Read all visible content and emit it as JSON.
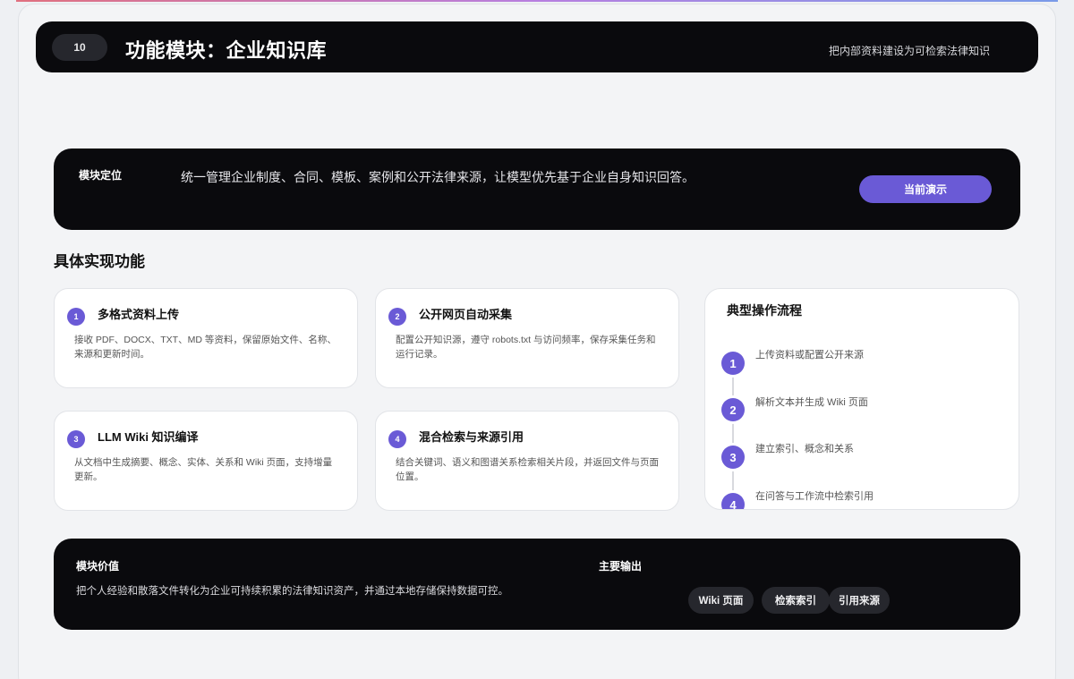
{
  "header": {
    "page_number": "10",
    "title": "功能模块：企业知识库",
    "subtitle": "把内部资料建设为可检索法律知识"
  },
  "positioning": {
    "label": "模块定位",
    "description": "统一管理企业制度、合同、模板、案例和公开法律来源，让模型优先基于企业自身知识回答。",
    "button_label": "当前演示"
  },
  "section_title": "具体实现功能",
  "features": [
    {
      "number": "1",
      "title": "多格式资料上传",
      "description": "接收 PDF、DOCX、TXT、MD 等资料，保留原始文件、名称、来源和更新时间。"
    },
    {
      "number": "2",
      "title": "公开网页自动采集",
      "description": "配置公开知识源，遵守 robots.txt 与访问频率，保存采集任务和运行记录。"
    },
    {
      "number": "3",
      "title": "LLM Wiki 知识编译",
      "description": "从文档中生成摘要、概念、实体、关系和 Wiki 页面，支持增量更新。"
    },
    {
      "number": "4",
      "title": "混合检索与来源引用",
      "description": "结合关键词、语义和图谱关系检索相关片段，并返回文件与页面位置。"
    }
  ],
  "flow": {
    "title": "典型操作流程",
    "steps": [
      {
        "number": "1",
        "text": "上传资料或配置公开来源"
      },
      {
        "number": "2",
        "text": "解析文本并生成 Wiki 页面"
      },
      {
        "number": "3",
        "text": "建立索引、概念和关系"
      },
      {
        "number": "4",
        "text": "在问答与工作流中检索引用"
      }
    ]
  },
  "value": {
    "label": "模块价值",
    "description": "把个人经验和散落文件转化为企业可持续积累的法律知识资产，并通过本地存储保持数据可控。",
    "outputs_label": "主要输出",
    "outputs": [
      "Wiki 页面",
      "检索索引",
      "引用来源"
    ]
  },
  "colors": {
    "accent": "#6a5ad6",
    "dark_panel": "#0a0a0d",
    "background": "#f3f4f6"
  }
}
